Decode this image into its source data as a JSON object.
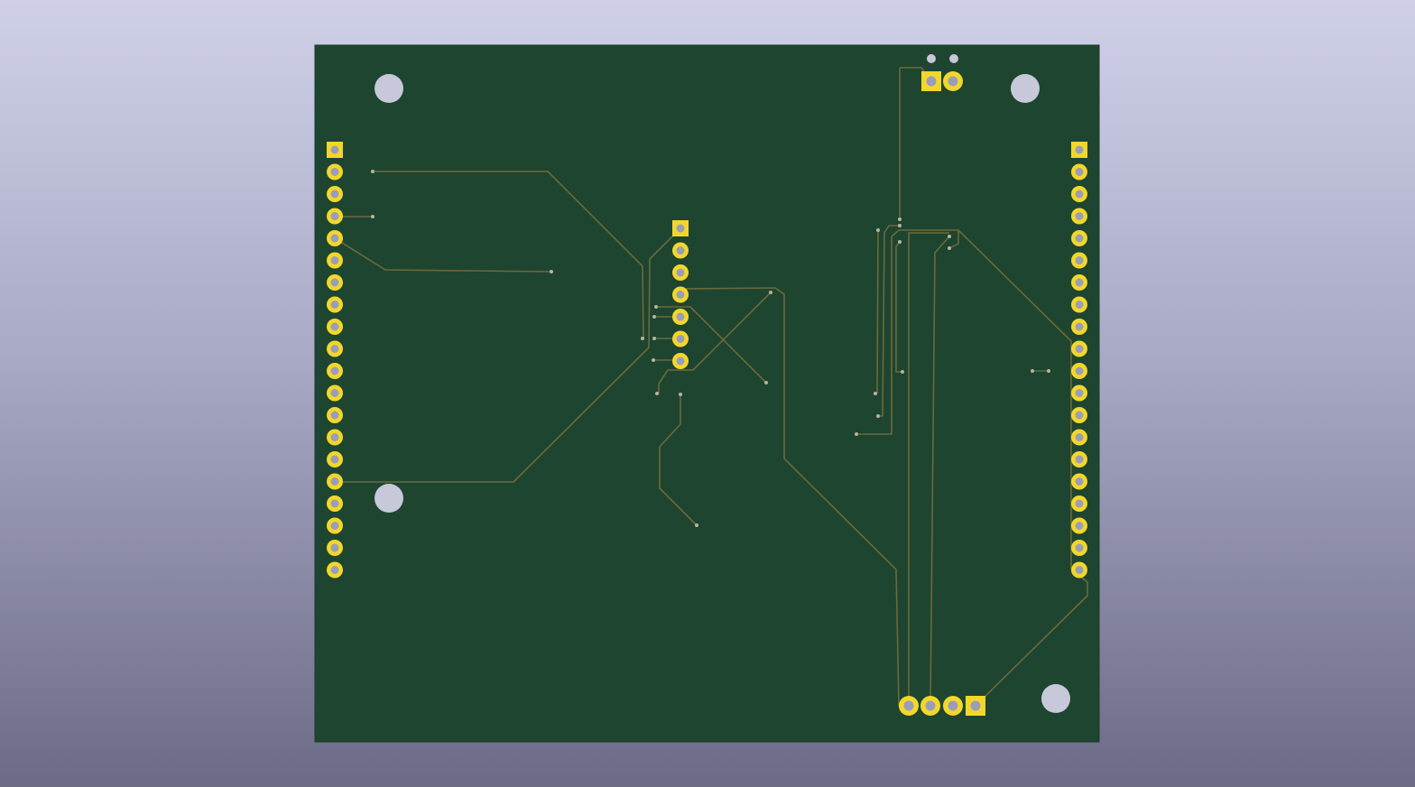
{
  "viewer": {
    "background_top": "#cfd0e8",
    "background_bottom": "#6b6b86"
  },
  "board": {
    "color": "#1e4530",
    "edge_color": "#1a3a28",
    "pad_color": "#f2d72b",
    "hole_color": "#9b9db6",
    "track_color": "#6b6a3a",
    "via_color": "#b7b4a0",
    "mounting_hole_color": "#c7c8da"
  },
  "components": {
    "left_header": {
      "pins": 20,
      "first_pin": "square"
    },
    "right_header": {
      "pins": 20,
      "first_pin": "square"
    },
    "center_header": {
      "pins": 7,
      "first_pin": "square"
    },
    "top_connector": {
      "pins": 2,
      "first_pin": "square"
    },
    "bottom_connector": {
      "pins": 4,
      "first_pin": "square"
    },
    "mounting_holes": 4
  }
}
